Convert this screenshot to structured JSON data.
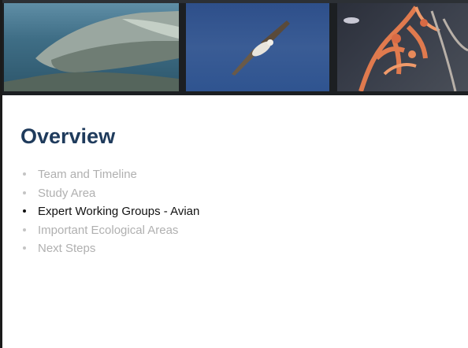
{
  "slide": {
    "title": "Overview",
    "banner_images": [
      {
        "icon": "whale-image"
      },
      {
        "icon": "seabird-image"
      },
      {
        "icon": "coral-image"
      }
    ],
    "bullets": [
      {
        "label": "Team and Timeline",
        "active": false
      },
      {
        "label": "Study Area",
        "active": false
      },
      {
        "label": "Expert Working Groups - Avian",
        "active": true
      },
      {
        "label": "Important Ecological Areas",
        "active": false
      },
      {
        "label": "Next Steps",
        "active": false
      }
    ]
  },
  "colors": {
    "title": "#1f3b5c",
    "active_text": "#111111",
    "inactive_text": "#b0b0b0"
  }
}
